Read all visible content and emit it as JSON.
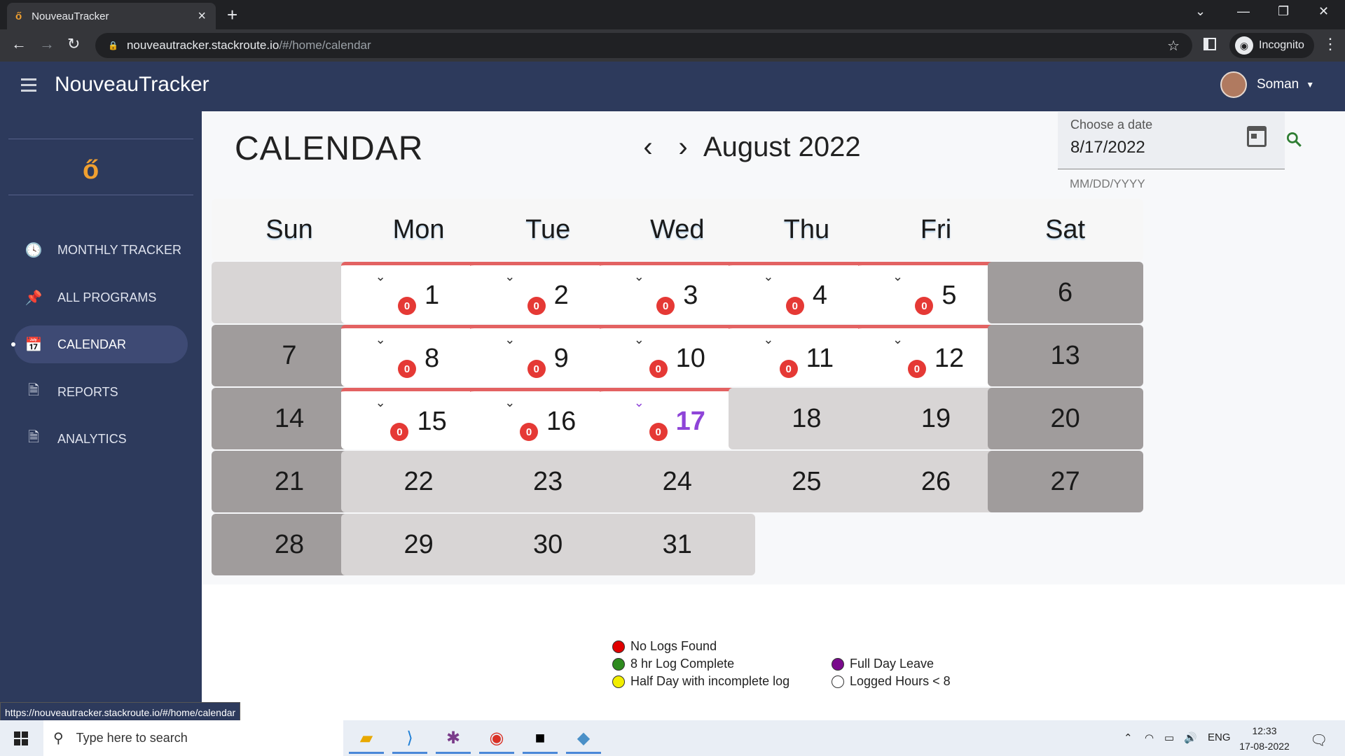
{
  "browser": {
    "tab_title": "NouveauTracker",
    "url_host": "nouveautracker.stackroute.io",
    "url_path": "/#/home/calendar",
    "profile_label": "Incognito",
    "status_url": "https://nouveautracker.stackroute.io/#/home/calendar"
  },
  "app": {
    "title": "NouveauTracker",
    "user_name": "Soman"
  },
  "sidebar": {
    "items": [
      {
        "label": "MONTHLY TRACKER",
        "icon": "clock-icon"
      },
      {
        "label": "ALL PROGRAMS",
        "icon": "pin-icon"
      },
      {
        "label": "CALENDAR",
        "icon": "calendar-icon",
        "active": true
      },
      {
        "label": "REPORTS",
        "icon": "document-icon"
      },
      {
        "label": "ANALYTICS",
        "icon": "document-icon"
      }
    ]
  },
  "calendar": {
    "title": "CALENDAR",
    "month_label": "August 2022",
    "date_field": {
      "label": "Choose a date",
      "value": "8/17/2022",
      "hint": "MM/DD/YYYY"
    },
    "weekdays": [
      "Sun",
      "Mon",
      "Tue",
      "Wed",
      "Thu",
      "Fri",
      "Sat"
    ],
    "badge_count": "0",
    "days": [
      {
        "n": "",
        "type": "blank"
      },
      {
        "n": "1",
        "type": "logged"
      },
      {
        "n": "2",
        "type": "logged"
      },
      {
        "n": "3",
        "type": "logged"
      },
      {
        "n": "4",
        "type": "logged"
      },
      {
        "n": "5",
        "type": "logged"
      },
      {
        "n": "6",
        "type": "wkend"
      },
      {
        "n": "7",
        "type": "wkend"
      },
      {
        "n": "8",
        "type": "logged"
      },
      {
        "n": "9",
        "type": "logged"
      },
      {
        "n": "10",
        "type": "logged"
      },
      {
        "n": "11",
        "type": "logged"
      },
      {
        "n": "12",
        "type": "logged"
      },
      {
        "n": "13",
        "type": "wkend"
      },
      {
        "n": "14",
        "type": "wkend"
      },
      {
        "n": "15",
        "type": "logged"
      },
      {
        "n": "16",
        "type": "logged"
      },
      {
        "n": "17",
        "type": "logged",
        "today": true
      },
      {
        "n": "18",
        "type": "future"
      },
      {
        "n": "19",
        "type": "future"
      },
      {
        "n": "20",
        "type": "wkend"
      },
      {
        "n": "21",
        "type": "wkend"
      },
      {
        "n": "22",
        "type": "future"
      },
      {
        "n": "23",
        "type": "future"
      },
      {
        "n": "24",
        "type": "future"
      },
      {
        "n": "25",
        "type": "future"
      },
      {
        "n": "26",
        "type": "future"
      },
      {
        "n": "27",
        "type": "wkend"
      },
      {
        "n": "28",
        "type": "wkend"
      },
      {
        "n": "29",
        "type": "future"
      },
      {
        "n": "30",
        "type": "future"
      },
      {
        "n": "31",
        "type": "future"
      }
    ]
  },
  "legend": [
    {
      "label": "No Logs Found",
      "color": "#e00000"
    },
    {
      "label": "8 hr Log Complete",
      "color": "#2e8b1f"
    },
    {
      "label": "Half Day with incomplete log",
      "color": "#f2ee00"
    },
    {
      "label": "Full Day Leave",
      "color": "#7a0a8c"
    },
    {
      "label": "Logged Hours < 8",
      "color": "#ffffff"
    }
  ],
  "taskbar": {
    "search_placeholder": "Type here to search",
    "language": "ENG",
    "time": "12:33",
    "date": "17-08-2022"
  }
}
